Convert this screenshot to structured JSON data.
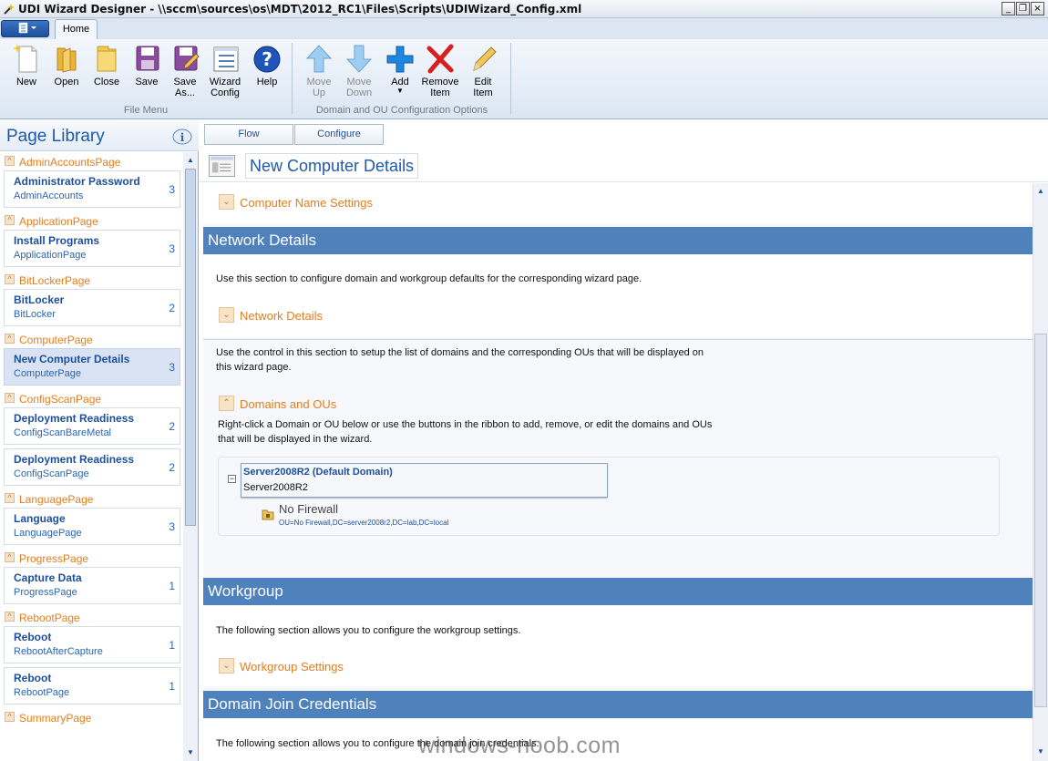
{
  "window": {
    "title": "UDI Wizard Designer - \\\\sccm\\sources\\os\\MDT\\2012_RC1\\Files\\Scripts\\UDIWizard_Config.xml",
    "minimize": "_",
    "maximize": "❐",
    "close": "×"
  },
  "ribbon": {
    "tab_home": "Home",
    "file_menu": {
      "label": "File Menu",
      "buttons": [
        {
          "label": "New",
          "icon": "new-document-icon"
        },
        {
          "label": "Open",
          "icon": "open-folder-icon"
        },
        {
          "label": "Close",
          "icon": "close-folder-icon"
        },
        {
          "label": "Save",
          "icon": "save-icon"
        },
        {
          "label": "Save As...",
          "icon": "save-as-icon"
        },
        {
          "label": "Wizard Config",
          "icon": "wizard-config-icon"
        },
        {
          "label": "Help",
          "icon": "help-icon"
        }
      ]
    },
    "domain_group": {
      "label": "Domain and OU Configuration Options",
      "buttons": [
        {
          "label": "Move Up",
          "icon": "arrow-up-icon",
          "enabled": false
        },
        {
          "label": "Move Down",
          "icon": "arrow-down-icon",
          "enabled": false
        },
        {
          "label": "Add",
          "icon": "plus-icon",
          "enabled": true
        },
        {
          "label": "Remove Item",
          "icon": "red-x-icon",
          "enabled": true
        },
        {
          "label": "Edit Item",
          "icon": "pencil-icon",
          "enabled": true
        }
      ]
    }
  },
  "library": {
    "title": "Page Library",
    "groups": [
      {
        "category": "AdminAccountsPage",
        "items": [
          {
            "title": "Administrator Password",
            "sub": "AdminAccounts",
            "count": "3"
          }
        ]
      },
      {
        "category": "ApplicationPage",
        "items": [
          {
            "title": "Install Programs",
            "sub": "ApplicationPage",
            "count": "3"
          }
        ]
      },
      {
        "category": "BitLockerPage",
        "items": [
          {
            "title": "BitLocker",
            "sub": "BitLocker",
            "count": "2"
          }
        ]
      },
      {
        "category": "ComputerPage",
        "items": [
          {
            "title": "New Computer Details",
            "sub": "ComputerPage",
            "count": "3",
            "selected": true
          }
        ]
      },
      {
        "category": "ConfigScanPage",
        "items": [
          {
            "title": "Deployment Readiness",
            "sub": "ConfigScanBareMetal",
            "count": "2"
          },
          {
            "title": "Deployment Readiness",
            "sub": "ConfigScanPage",
            "count": "2"
          }
        ]
      },
      {
        "category": "LanguagePage",
        "items": [
          {
            "title": "Language",
            "sub": "LanguagePage",
            "count": "3"
          }
        ]
      },
      {
        "category": "ProgressPage",
        "items": [
          {
            "title": "Capture Data",
            "sub": "ProgressPage",
            "count": "1"
          }
        ]
      },
      {
        "category": "RebootPage",
        "items": [
          {
            "title": "Reboot",
            "sub": "RebootAfterCapture",
            "count": "1"
          },
          {
            "title": "Reboot",
            "sub": "RebootPage",
            "count": "1"
          }
        ]
      },
      {
        "category": "SummaryPage",
        "items": []
      }
    ]
  },
  "main": {
    "tabs": [
      "Flow",
      "Configure"
    ],
    "page_title": "New Computer Details",
    "computer_name_settings": "Computer Name Settings",
    "network": {
      "heading": "Network Details",
      "desc": "Use this section to configure domain and workgroup defaults for the corresponding wizard page.",
      "expander": "Network Details",
      "desc2_line1": "Use the control in this section to setup the list of domains and the corresponding OUs that will be displayed on",
      "desc2_line2": "this wizard page.",
      "domains_expander": "Domains and OUs",
      "desc3_line1": "Right-click a Domain or OU below or use the buttons in the ribbon to add, remove, or edit the domains and OUs",
      "desc3_line2": "that will be displayed in the wizard.",
      "domain": {
        "title": "Server2008R2 (Default Domain)",
        "name": "Server2008R2",
        "ou_name": "No Firewall",
        "ou_path": "OU=No Firewall,DC=server2008r2,DC=lab,DC=local"
      }
    },
    "workgroup": {
      "heading": "Workgroup",
      "desc": "The following section allows you to configure the workgroup settings.",
      "expander": "Workgroup Settings"
    },
    "domain_join": {
      "heading": "Domain Join Credentials",
      "desc": "The following section allows you to configure the domain join credentials."
    }
  },
  "watermark": "windows-noob.com"
}
